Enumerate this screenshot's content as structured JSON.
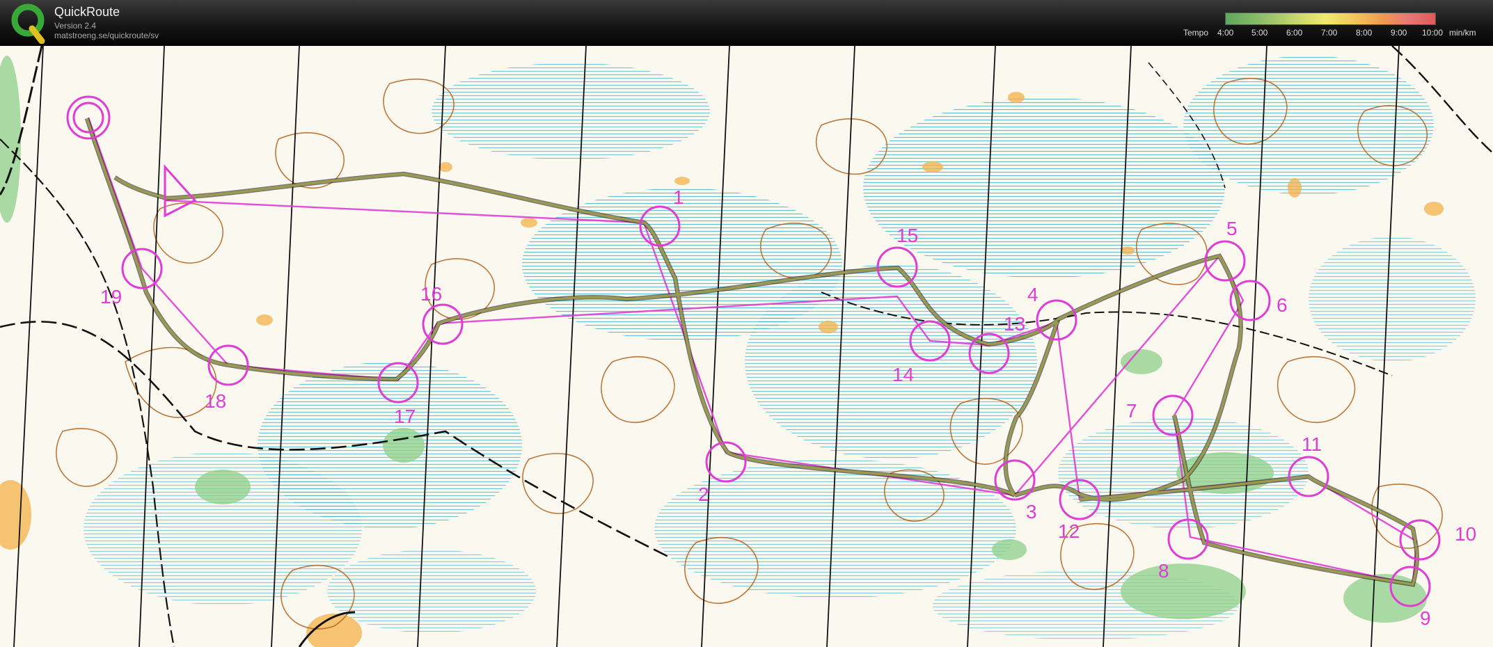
{
  "app": {
    "title": "QuickRoute",
    "version": "Version 2.4",
    "url": "matstroeng.se/quickroute/sv"
  },
  "legend": {
    "label": "Tempo",
    "ticks": [
      "4:00",
      "5:00",
      "6:00",
      "7:00",
      "8:00",
      "9:00",
      "10:00"
    ],
    "unit": "min/km",
    "colors": [
      "#5da85d",
      "#c9d76e",
      "#f1ea6f",
      "#ee9a52",
      "#e05a5a"
    ]
  },
  "course": {
    "color": "#e03cd6",
    "controls": [
      "1",
      "2",
      "3",
      "4",
      "5",
      "6",
      "7",
      "8",
      "9",
      "10",
      "11",
      "12",
      "13",
      "14",
      "15",
      "16",
      "17",
      "18",
      "19"
    ]
  },
  "map": {
    "colors": {
      "paper": "#fbf8ef",
      "marsh": "#3db3cf",
      "vegetation": "#8fd08a",
      "contour": "#b2611b",
      "open": "#f4b24a",
      "route": "#8d8a49",
      "north_lines": "#111111"
    }
  }
}
